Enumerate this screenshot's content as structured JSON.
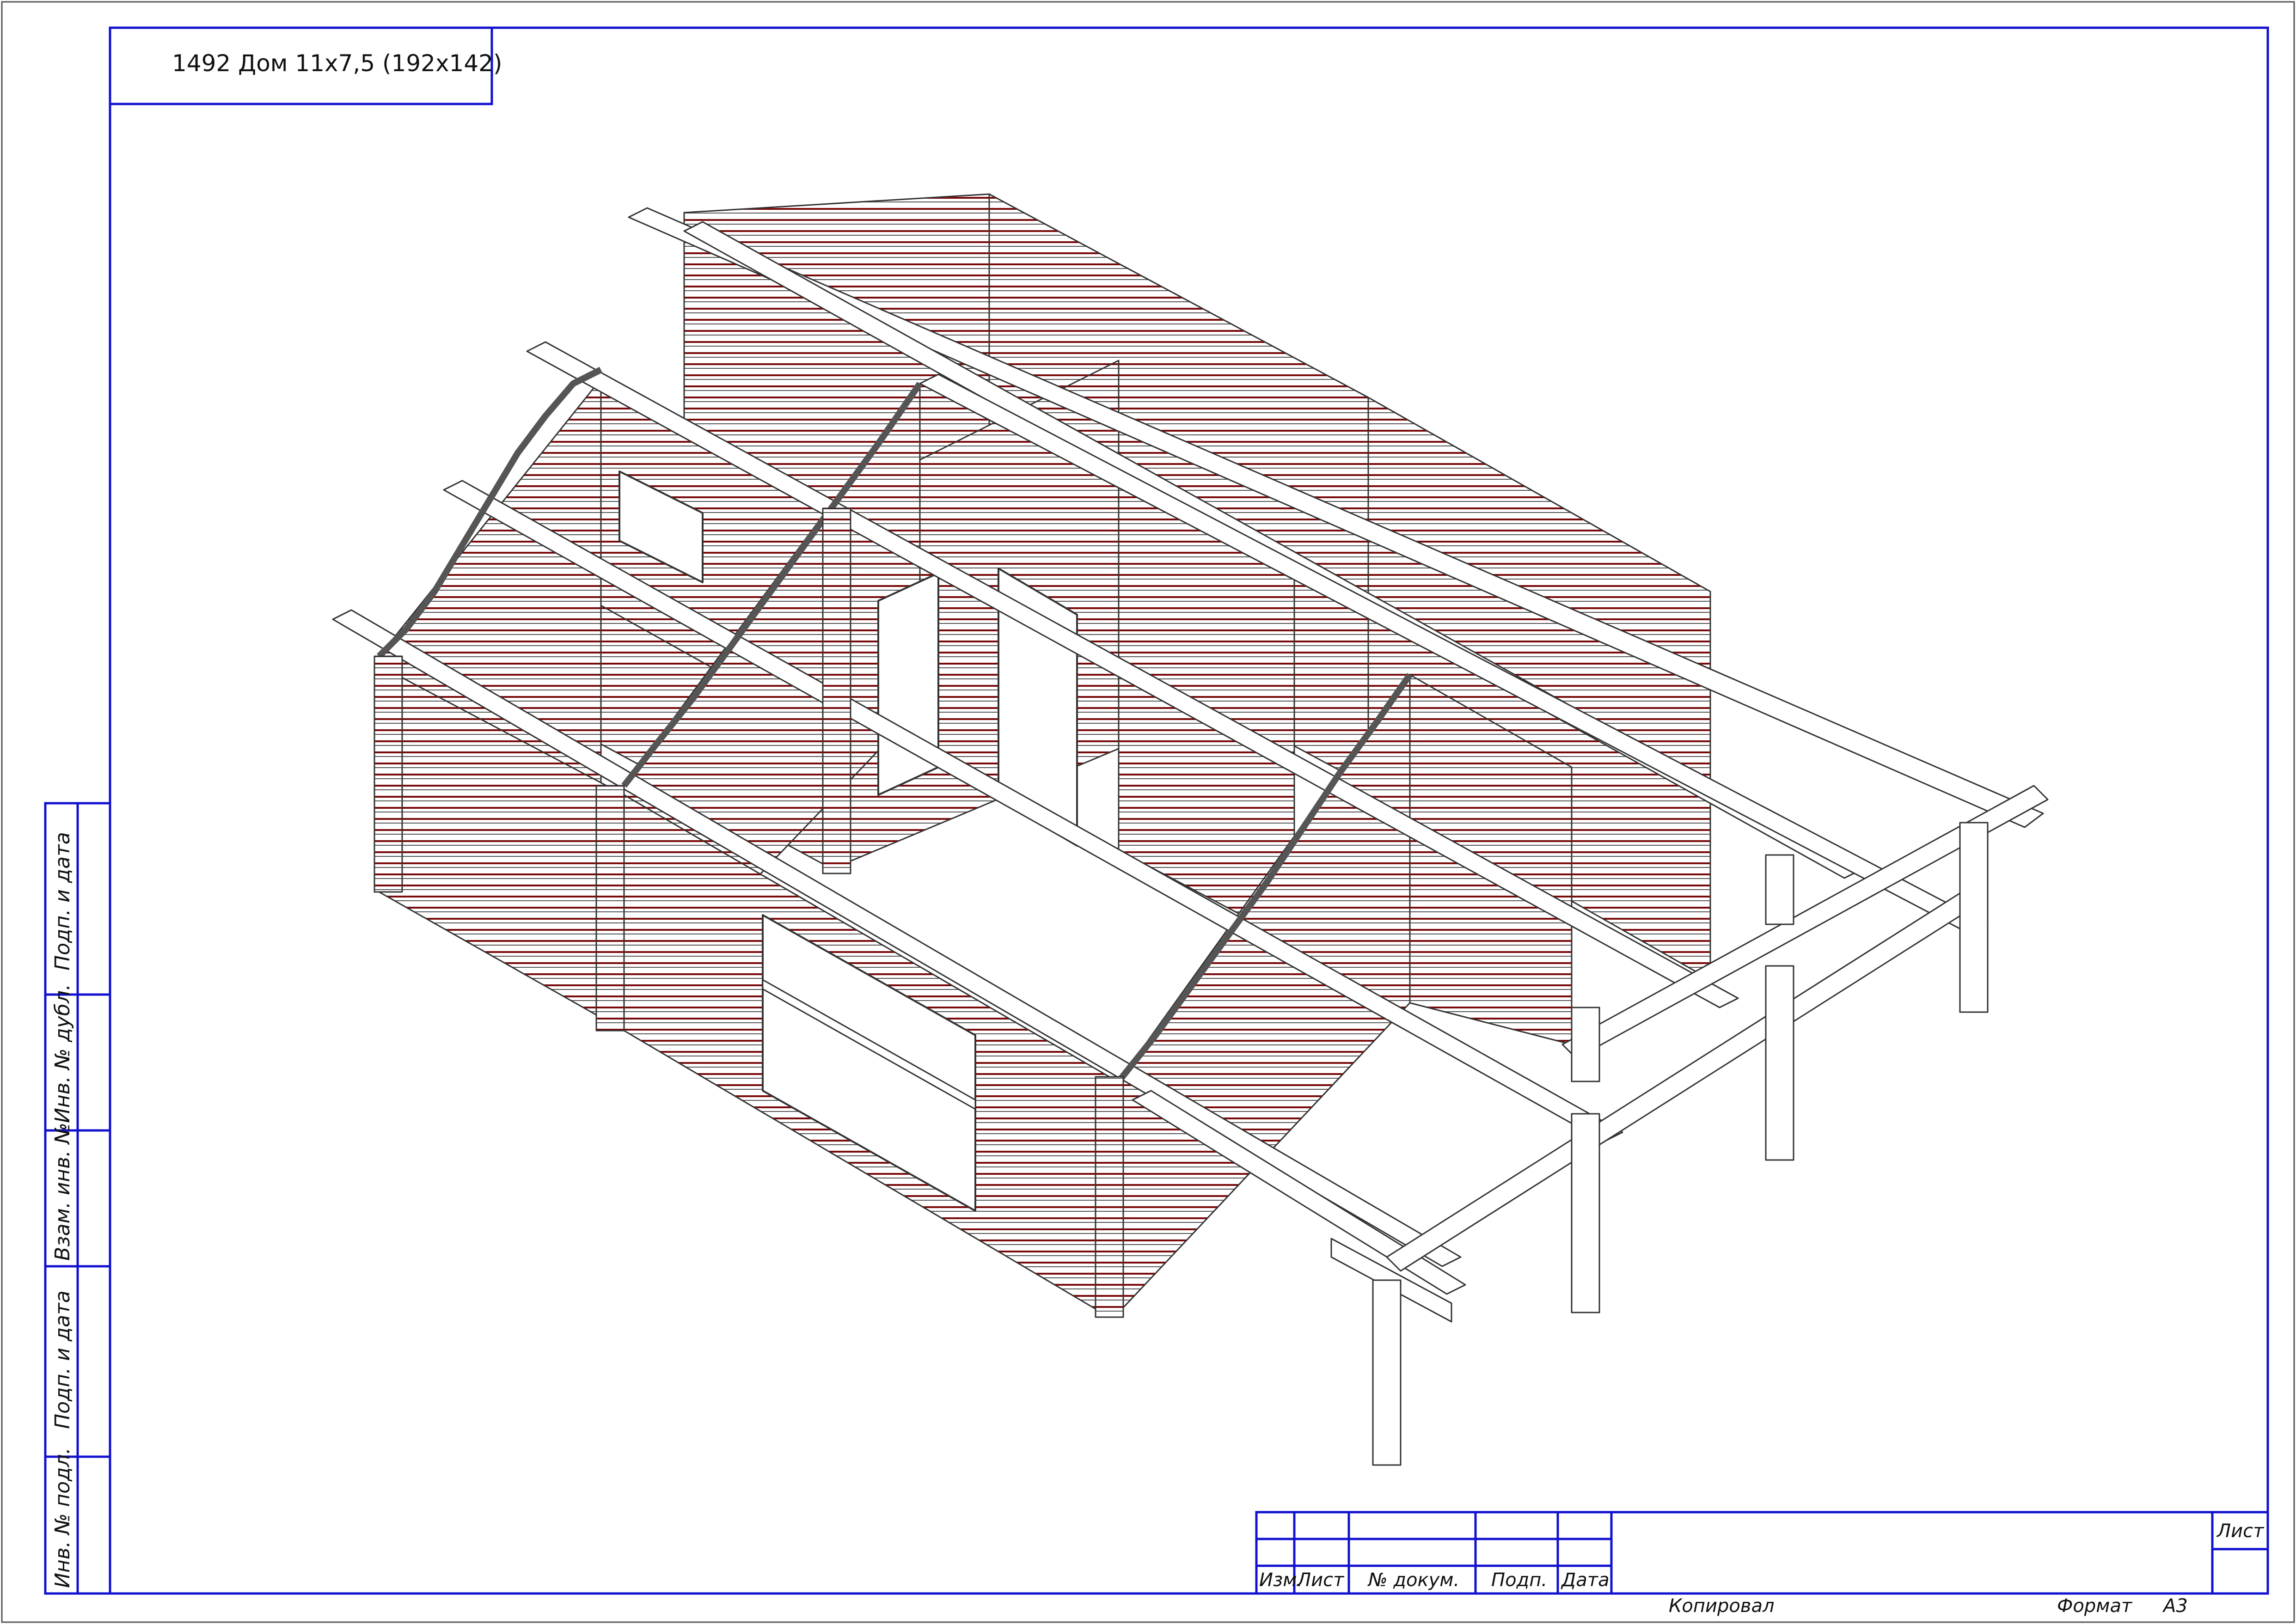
{
  "title_block": {
    "drawing_title": "1492 Дом 11х7,5 (192х142)"
  },
  "side_stamp": {
    "labels": [
      "Подп. и дата",
      "Инв. № дубл.",
      "Взам. инв. №",
      "Подп. и дата",
      "Инв. № подл."
    ]
  },
  "main_stamp": {
    "col_izm": "Изм.",
    "col_list": "Лист",
    "col_doc": "№ докум.",
    "col_podp": "Подп.",
    "col_data": "Дата",
    "sheet_label": "Лист"
  },
  "footer": {
    "copied_label": "Копировал",
    "format_label": "Формат",
    "format_value": "А3"
  },
  "colors": {
    "frame": "#1010d0",
    "log_lines": "#7a0a0a",
    "outline": "#333333"
  },
  "drawing": {
    "subject": "isometric view of log house frame with gables, beams and porch posts"
  }
}
